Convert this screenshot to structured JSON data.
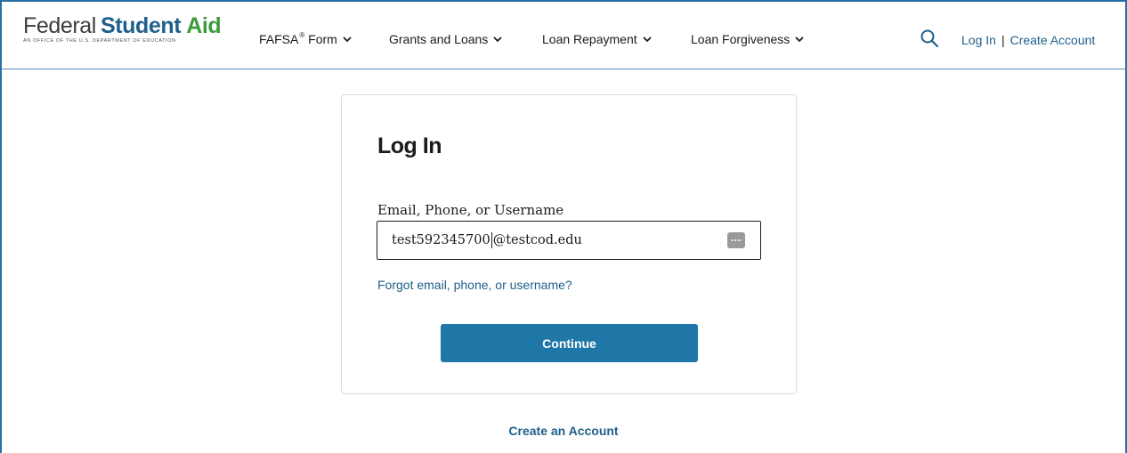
{
  "header": {
    "logo": {
      "federal": "Federal",
      "student": "Student",
      "aid": "Aid",
      "tagline": "An OFFICE of the U.S. DEPARTMENT of EDUCATION"
    },
    "nav": [
      {
        "label": "FAFSA",
        "sup": "®",
        "suffix": " Form"
      },
      {
        "label": "Grants and Loans"
      },
      {
        "label": "Loan Repayment"
      },
      {
        "label": "Loan Forgiveness"
      }
    ],
    "search_icon": "search-icon",
    "login_label": "Log In",
    "separator": "|",
    "create_account_label": "Create Account"
  },
  "login": {
    "title": "Log In",
    "field_label": "Email, Phone, or Username",
    "value_before_caret": "test592345700",
    "value_after_caret": "@testcod.edu",
    "forgot_link": "Forgot email, phone, or username?",
    "continue_label": "Continue"
  },
  "footer": {
    "create_account_link": "Create an Account"
  },
  "colors": {
    "brand_blue": "#1f5f8b",
    "button_blue": "#1f77a8",
    "aid_green": "#3c9b3c",
    "frame_blue": "#2a6fa3"
  }
}
